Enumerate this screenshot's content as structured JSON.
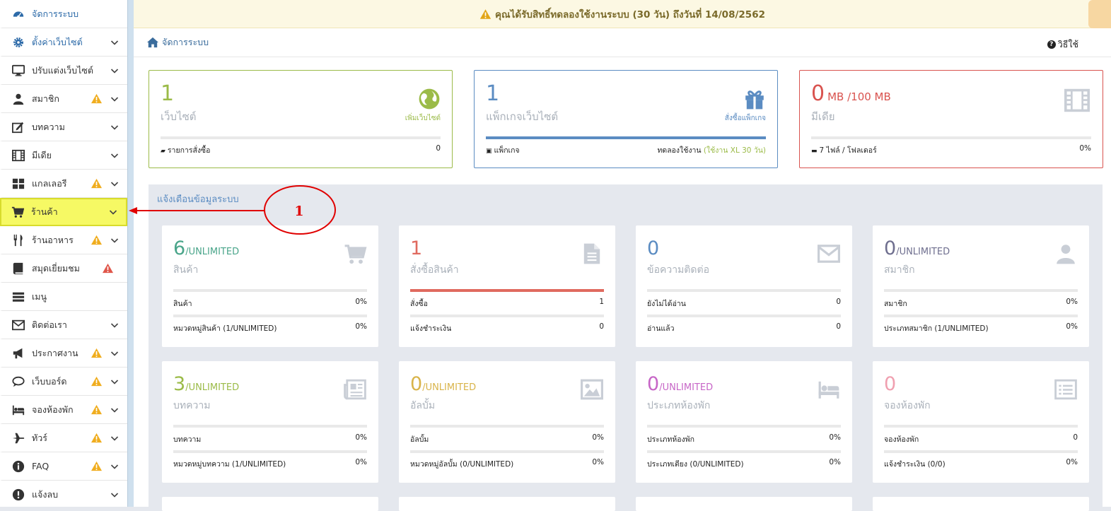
{
  "notice": {
    "text": "คุณได้รับสิทธิ์ทดลองใช้งานระบบ (30 วัน) ถึงวันที่ 14/08/2562"
  },
  "breadcrumb": {
    "home": "จัดการระบบ"
  },
  "help": {
    "label": "วิธีใช้"
  },
  "sidebar": {
    "items": [
      {
        "label": "จัดการระบบ",
        "icon": "dashboard-icon",
        "warn": false,
        "chevron": false
      },
      {
        "label": "ตั้งค่าเว็บไซต์",
        "icon": "gear-icon",
        "warn": false,
        "chevron": true
      },
      {
        "label": "ปรับแต่งเว็บไซต์",
        "icon": "monitor-icon",
        "warn": false,
        "chevron": true
      },
      {
        "label": "สมาชิก",
        "icon": "user-icon",
        "warn": true,
        "chevron": true
      },
      {
        "label": "บทความ",
        "icon": "edit-icon",
        "warn": false,
        "chevron": true
      },
      {
        "label": "มีเดีย",
        "icon": "film-icon",
        "warn": false,
        "chevron": true
      },
      {
        "label": "แกลเลอรี",
        "icon": "grid-icon",
        "warn": true,
        "chevron": true
      },
      {
        "label": "ร้านค้า",
        "icon": "cart-icon",
        "warn": false,
        "chevron": true
      },
      {
        "label": "ร้านอาหาร",
        "icon": "utensils-icon",
        "warn": true,
        "chevron": true
      },
      {
        "label": "สมุดเยี่ยมชม",
        "icon": "book-icon",
        "warn": true,
        "chevron": false
      },
      {
        "label": "เมนู",
        "icon": "menu-icon",
        "warn": false,
        "chevron": false
      },
      {
        "label": "ติดต่อเรา",
        "icon": "envelope-icon",
        "warn": false,
        "chevron": true
      },
      {
        "label": "ประกาศงาน",
        "icon": "megaphone-icon",
        "warn": true,
        "chevron": true
      },
      {
        "label": "เว็บบอร์ด",
        "icon": "comments-icon",
        "warn": true,
        "chevron": true
      },
      {
        "label": "จองห้องพัก",
        "icon": "bed-icon",
        "warn": true,
        "chevron": true
      },
      {
        "label": "ทัวร์",
        "icon": "plane-icon",
        "warn": true,
        "chevron": true
      },
      {
        "label": "FAQ",
        "icon": "info-icon",
        "warn": true,
        "chevron": true
      },
      {
        "label": "แจ้งลบ",
        "icon": "exclamation-icon",
        "warn": false,
        "chevron": true
      }
    ]
  },
  "top_cards": [
    {
      "num": "1",
      "sub": "",
      "label": "เว็บไซต์",
      "link": "เพิ่มเว็บไซต์",
      "foot_left": "รายการสั่งซื้อ",
      "foot_right": "0",
      "foot_right_extra": "",
      "color": "#9bbb48",
      "icon": "globe-icon",
      "bar": 0
    },
    {
      "num": "1",
      "sub": "",
      "label": "แพ็กเกจเว็บไซต์",
      "link": "สั่งซื้อแพ็กเกจ",
      "foot_left": "แพ็กเกจ",
      "foot_right": "ทดลองใช้งาน",
      "foot_right_extra": "(ใช้งาน XL 30 วัน)",
      "color": "#5b8cc2",
      "icon": "gift-icon",
      "bar": 1
    },
    {
      "num": "0",
      "sub": "MB  /100 MB",
      "label": "มีเดีย",
      "link": "",
      "foot_left": "7 ไฟล์ / โฟลเดอร์",
      "foot_right": "0%",
      "foot_right_extra": "",
      "color": "#d9534f",
      "icon": "film-icon",
      "bar": 0
    }
  ],
  "alerts": {
    "heading": "แจ้งเตือนข้อมูลระบบ"
  },
  "stat_cards": [
    {
      "num": "6",
      "sub": "/UNLIMITED",
      "label": "สินค้า",
      "color": "#4aa58a",
      "icon": "cart-icon",
      "bar": 0,
      "bar_color": "#e9e9e9",
      "rows": [
        [
          "สินค้า",
          "0%"
        ],
        [
          "หมวดหมู่สินค้า (1/UNLIMITED)",
          "0%"
        ]
      ]
    },
    {
      "num": "1",
      "sub": "",
      "label": "สั่งซื้อสินค้า",
      "color": "#e06a5f",
      "icon": "file-icon",
      "bar": 1,
      "bar_color": "#e06a5f",
      "rows": [
        [
          "สั่งซื้อ",
          "1"
        ],
        [
          "แจ้งชำระเงิน",
          "0"
        ]
      ]
    },
    {
      "num": "0",
      "sub": "",
      "label": "ข้อความติดต่อ",
      "color": "#5b8cc2",
      "icon": "envelope-icon",
      "bar": 0,
      "bar_color": "#e9e9e9",
      "rows": [
        [
          "ยังไม่ได้อ่าน",
          "0"
        ],
        [
          "อ่านแล้ว",
          "0"
        ]
      ]
    },
    {
      "num": "0",
      "sub": "/UNLIMITED",
      "label": "สมาชิก",
      "color": "#6f6f8f",
      "icon": "user-icon",
      "bar": 0,
      "bar_color": "#e9e9e9",
      "rows": [
        [
          "สมาชิก",
          "0%"
        ],
        [
          "ประเภทสมาชิก (1/UNLIMITED)",
          "0%"
        ]
      ]
    },
    {
      "num": "3",
      "sub": "/UNLIMITED",
      "label": "บทความ",
      "color": "#9bbb48",
      "icon": "newspaper-icon",
      "bar": 0,
      "bar_color": "#e9e9e9",
      "rows": [
        [
          "บทความ",
          "0%"
        ],
        [
          "หมวดหมู่บทความ (1/UNLIMITED)",
          "0%"
        ]
      ]
    },
    {
      "num": "0",
      "sub": "/UNLIMITED",
      "label": "อัลบั้ม",
      "color": "#d9b44a",
      "icon": "image-icon",
      "bar": 0,
      "bar_color": "#e9e9e9",
      "rows": [
        [
          "อัลบั้ม",
          "0%"
        ],
        [
          "หมวดหมู่อัลบั้ม (0/UNLIMITED)",
          "0%"
        ]
      ]
    },
    {
      "num": "0",
      "sub": "/UNLIMITED",
      "label": "ประเภทห้องพัก",
      "color": "#c766c7",
      "icon": "bed-icon",
      "bar": 0,
      "bar_color": "#e9e9e9",
      "rows": [
        [
          "ประเภทห้องพัก",
          "0%"
        ],
        [
          "ประเภทเตียง (0/UNLIMITED)",
          "0%"
        ]
      ]
    },
    {
      "num": "0",
      "sub": "",
      "label": "จองห้องพัก",
      "color": "#f0a0b0",
      "icon": "list-icon",
      "bar": 0,
      "bar_color": "#e9e9e9",
      "rows": [
        [
          "จองห้องพัก",
          "0"
        ],
        [
          "แจ้งชำระเงิน (0/0)",
          "0%"
        ]
      ]
    }
  ],
  "annotation": {
    "label": "1"
  }
}
